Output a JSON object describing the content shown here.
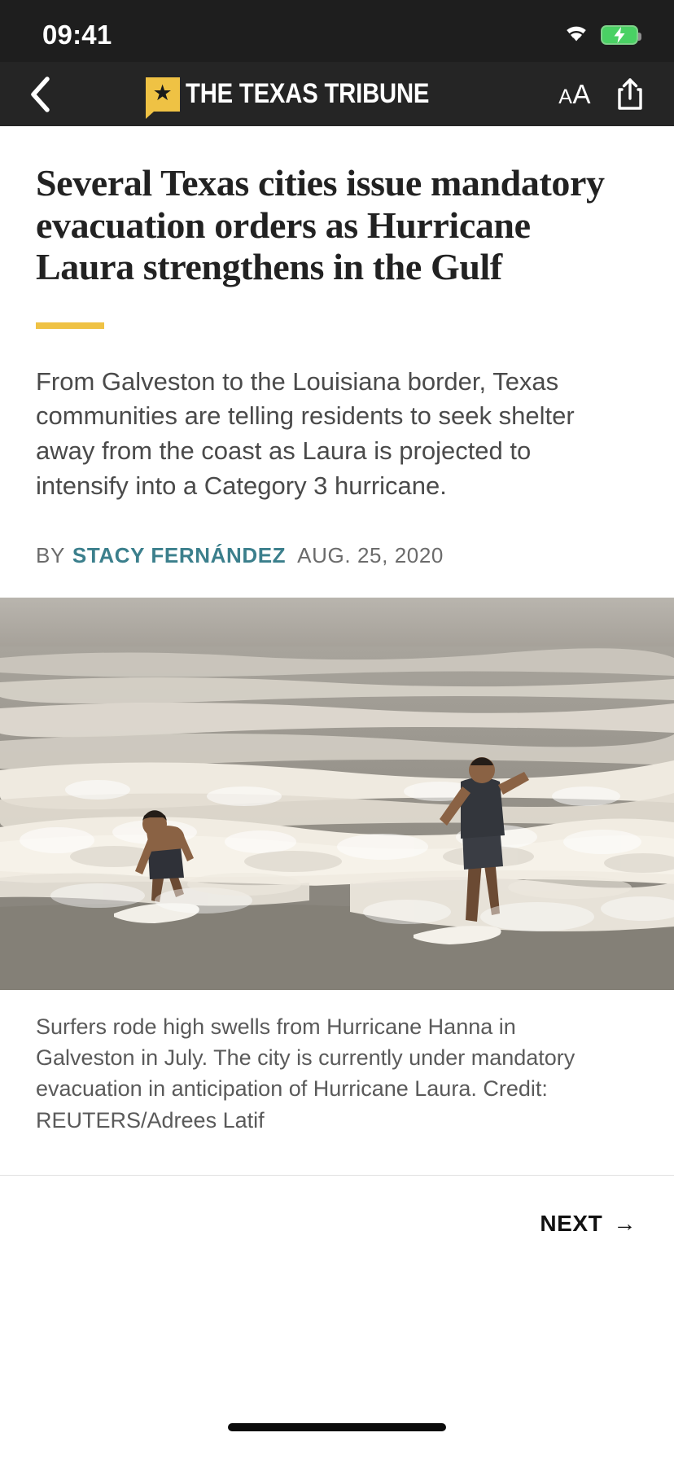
{
  "status_bar": {
    "time": "09:41",
    "wifi_icon": "wifi-icon",
    "battery_icon": "battery-charging-icon",
    "background_color": "#1e1e1e"
  },
  "nav_bar": {
    "back_icon": "back-chevron-icon",
    "logo": {
      "star_glyph": "★",
      "wordmark": "THE TEXAS TRIBUNE",
      "badge_color": "#efc244"
    },
    "text_size_label_small": "A",
    "text_size_label_large": "A",
    "share_icon": "share-icon",
    "background_color": "#252525"
  },
  "article": {
    "headline": "Several Texas cities issue mandatory evacuation orders as Hurricane Laura strengthens in the Gulf",
    "divider_color": "#efc244",
    "deck": "From Galveston to the Louisiana border, Texas communities are telling residents to seek shelter away from the coast as Laura is projected to intensify into a Category 3 hurricane.",
    "byline": {
      "by_label": "BY",
      "author": "STACY FERNÁNDEZ",
      "author_color": "#3b7f8c",
      "date": "AUG. 25, 2020"
    },
    "photo": {
      "alt": "Two surfers riding high brown swells on a gray overcast beach",
      "caption": "Surfers rode high swells from Hurricane Hanna in Galveston in July. The city is currently under mandatory evacuation in anticipation of Hurricane Laura. Credit: REUTERS/Adrees Latif"
    }
  },
  "footer": {
    "next_label": "NEXT",
    "next_arrow": "→",
    "home_indicator": "home-indicator"
  }
}
